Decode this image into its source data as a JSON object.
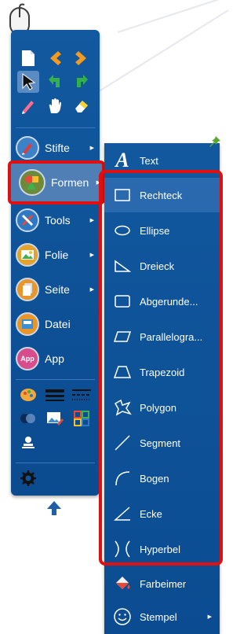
{
  "toolbar": {
    "items": [
      {
        "label": "Stifte",
        "icon": "pen-icon",
        "has_submenu": true
      },
      {
        "label": "Formen",
        "icon": "shapes-icon",
        "has_submenu": true
      },
      {
        "label": "Tools",
        "icon": "tools-icon",
        "has_submenu": true
      },
      {
        "label": "Folie",
        "icon": "slide-icon",
        "has_submenu": true
      },
      {
        "label": "Seite",
        "icon": "page-icon",
        "has_submenu": true
      },
      {
        "label": "Datei",
        "icon": "file-icon",
        "has_submenu": false
      },
      {
        "label": "App",
        "icon": "app-icon",
        "has_submenu": false
      }
    ],
    "app_badge": "App",
    "arrow_glyph": "▶",
    "colors": {
      "bg": "#0f549a",
      "active": "#4f7fb4",
      "highlight_border": "#e01010"
    }
  },
  "submenu": {
    "text_item": {
      "label": "Text",
      "icon_glyph": "A"
    },
    "items": [
      {
        "label": "Rechteck",
        "icon": "rectangle-icon"
      },
      {
        "label": "Ellipse",
        "icon": "ellipse-icon"
      },
      {
        "label": "Dreieck",
        "icon": "triangle-icon"
      },
      {
        "label": "Abgerunde...",
        "icon": "rounded-rectangle-icon"
      },
      {
        "label": "Parallelogra...",
        "icon": "parallelogram-icon"
      },
      {
        "label": "Trapezoid",
        "icon": "trapezoid-icon"
      },
      {
        "label": "Polygon",
        "icon": "polygon-icon"
      },
      {
        "label": "Segment",
        "icon": "segment-icon"
      },
      {
        "label": "Bogen",
        "icon": "arc-icon"
      },
      {
        "label": "Ecke",
        "icon": "angle-icon"
      },
      {
        "label": "Hyperbel",
        "icon": "hyperbola-icon"
      }
    ],
    "bottom_items": [
      {
        "label": "Farbeimer",
        "icon": "paint-bucket-icon"
      },
      {
        "label": "Stempel",
        "icon": "stamp-icon",
        "has_submenu": true
      }
    ],
    "highlighted": "Rechteck"
  }
}
